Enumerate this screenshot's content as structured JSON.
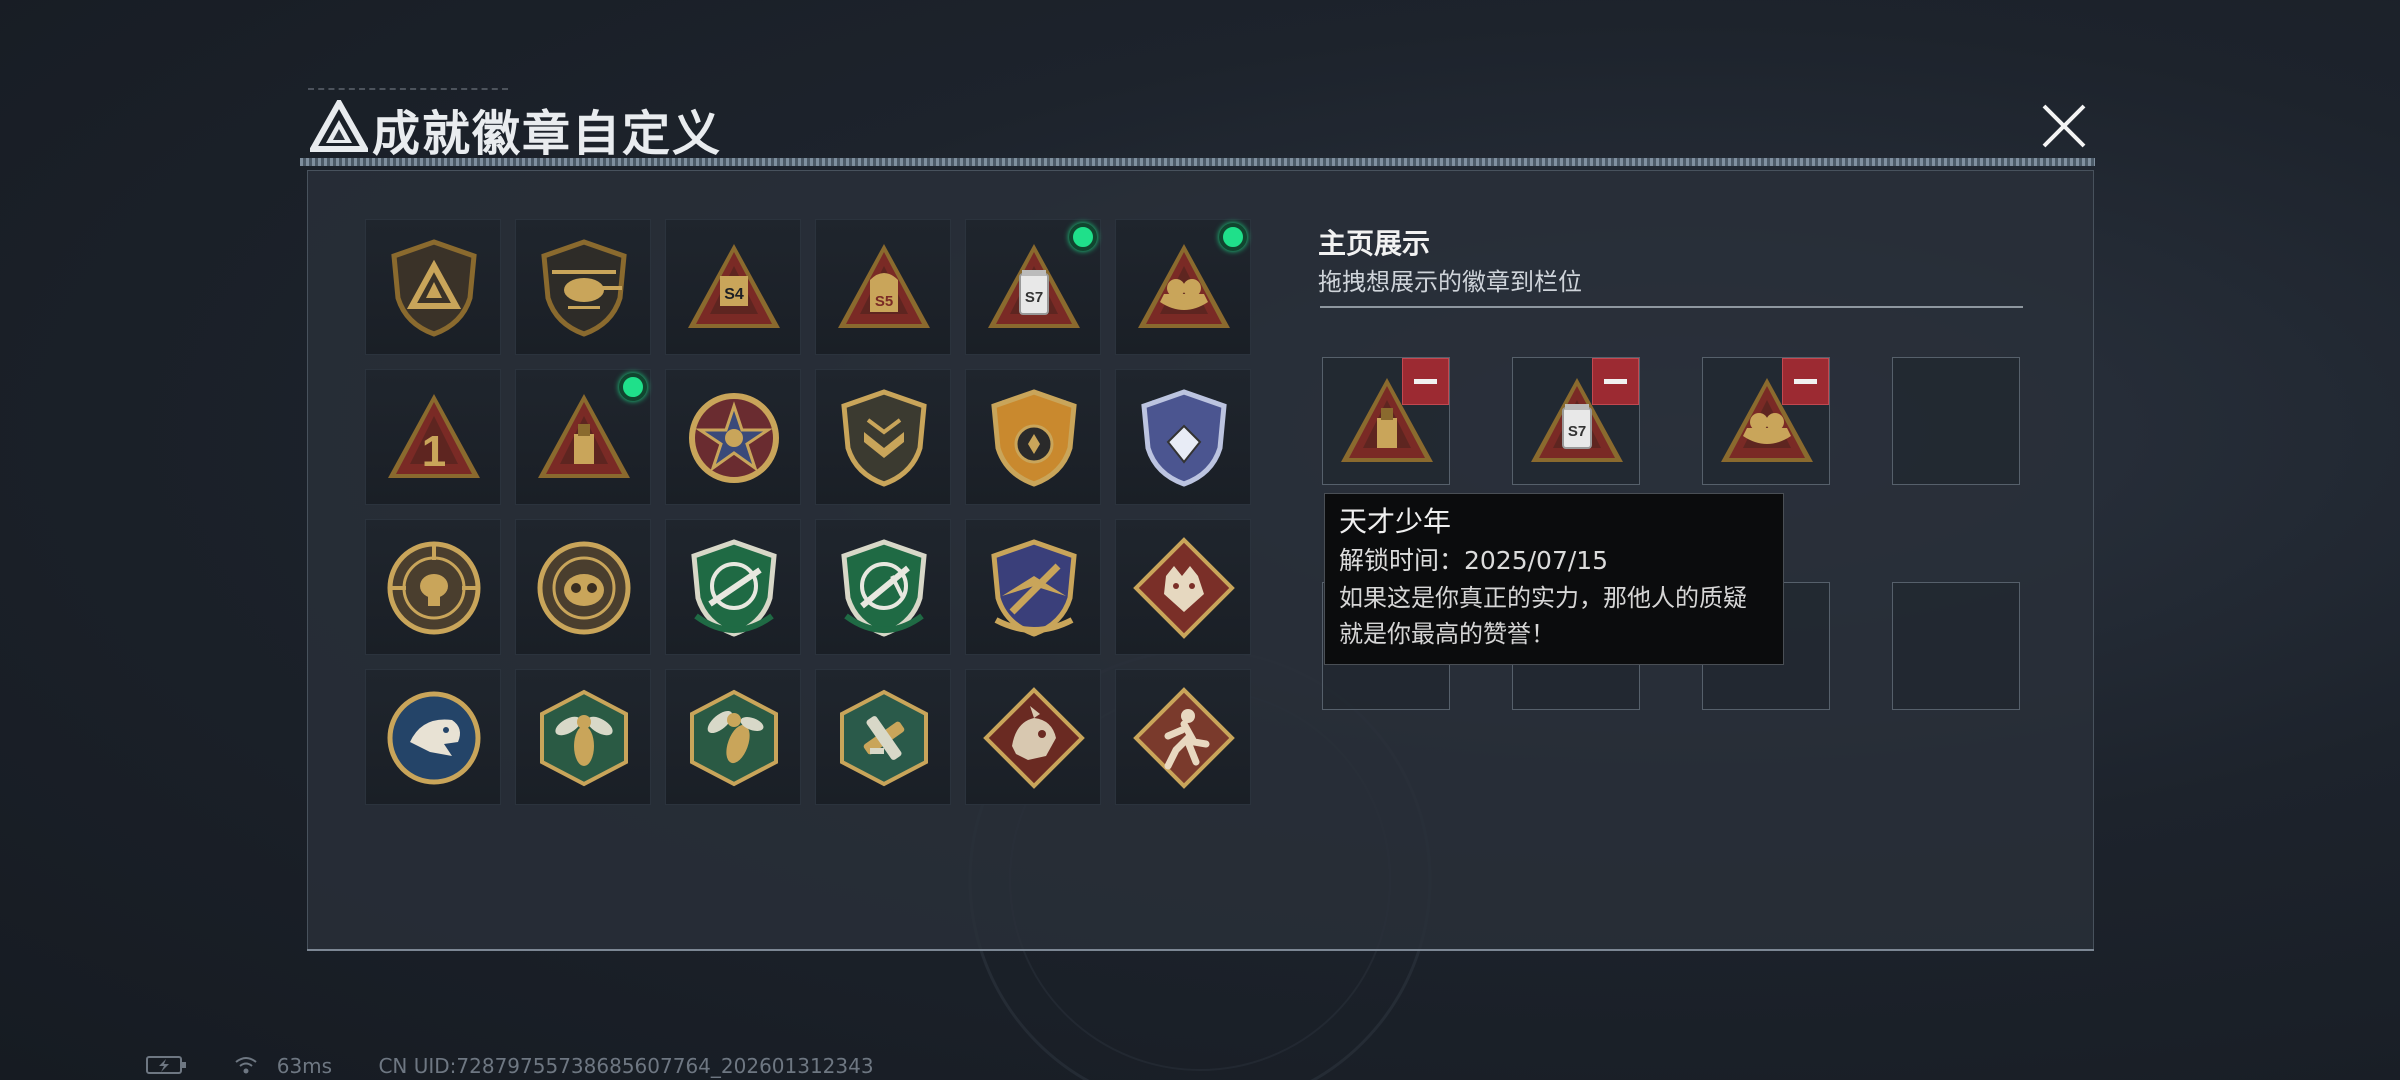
{
  "dialog": {
    "title": "成就徽章自定义",
    "close_icon": "close-icon"
  },
  "badges": [
    {
      "icon": "shield-triangle-badge",
      "equipped": false
    },
    {
      "icon": "helicopter-badge",
      "equipped": false
    },
    {
      "icon": "s4-triangle-badge",
      "label": "S4",
      "equipped": false
    },
    {
      "icon": "s5-triangle-badge",
      "label": "S5",
      "equipped": false
    },
    {
      "icon": "s7-canister-triangle-badge",
      "label": "S7",
      "equipped": true
    },
    {
      "icon": "gold-ingot-triangle-badge",
      "equipped": true
    },
    {
      "icon": "number-one-triangle-badge",
      "label": "1",
      "equipped": false
    },
    {
      "icon": "usb-triangle-badge",
      "equipped": true
    },
    {
      "icon": "star-medal-badge",
      "equipped": false
    },
    {
      "icon": "gold-chevron-shield-badge",
      "equipped": false
    },
    {
      "icon": "gold-stars-crest-badge",
      "equipped": false
    },
    {
      "icon": "blue-diamond-crest-badge",
      "equipped": false
    },
    {
      "icon": "skull-crosshair-badge",
      "equipped": false
    },
    {
      "icon": "mask-crosshair-badge",
      "equipped": false
    },
    {
      "icon": "green-rifle-shield-badge",
      "equipped": false
    },
    {
      "icon": "green-rifle-shield-2-badge",
      "equipped": false
    },
    {
      "icon": "gold-eagle-crest-badge",
      "equipped": false
    },
    {
      "icon": "wolf-diamond-badge",
      "equipped": false
    },
    {
      "icon": "eagle-circle-badge",
      "equipped": false
    },
    {
      "icon": "wasp-hexagon-badge",
      "equipped": false
    },
    {
      "icon": "wasp-hexagon-2-badge",
      "equipped": false
    },
    {
      "icon": "tools-hexagon-badge",
      "equipped": false
    },
    {
      "icon": "dragon-diamond-badge",
      "equipped": false
    },
    {
      "icon": "runner-diamond-badge",
      "equipped": false
    }
  ],
  "showcase": {
    "title": "主页展示",
    "subtitle": "拖拽想展示的徽章到栏位",
    "slots": [
      {
        "icon": "usb-triangle-badge",
        "filled": true
      },
      {
        "icon": "s7-canister-triangle-badge",
        "label": "S7",
        "filled": true
      },
      {
        "icon": "gold-ingot-triangle-badge",
        "filled": true
      },
      {
        "filled": false
      },
      {
        "filled": false
      },
      {
        "filled": false
      },
      {
        "filled": false
      },
      {
        "filled": false
      }
    ]
  },
  "tooltip": {
    "name": "天才少年",
    "unlock_time": "解锁时间：2025/07/15",
    "description": "如果这是你真正的实力，那他人的质疑就是你最高的赞誉！"
  },
  "status_bar": {
    "ping": "63ms",
    "uid": "CN UID:72879755738685607764_202601312343"
  },
  "colors": {
    "equipped_dot": "#1fe08a",
    "remove_button": "#9c2a32",
    "gold": "#c9a55a",
    "dark_red": "#7a2a25"
  }
}
